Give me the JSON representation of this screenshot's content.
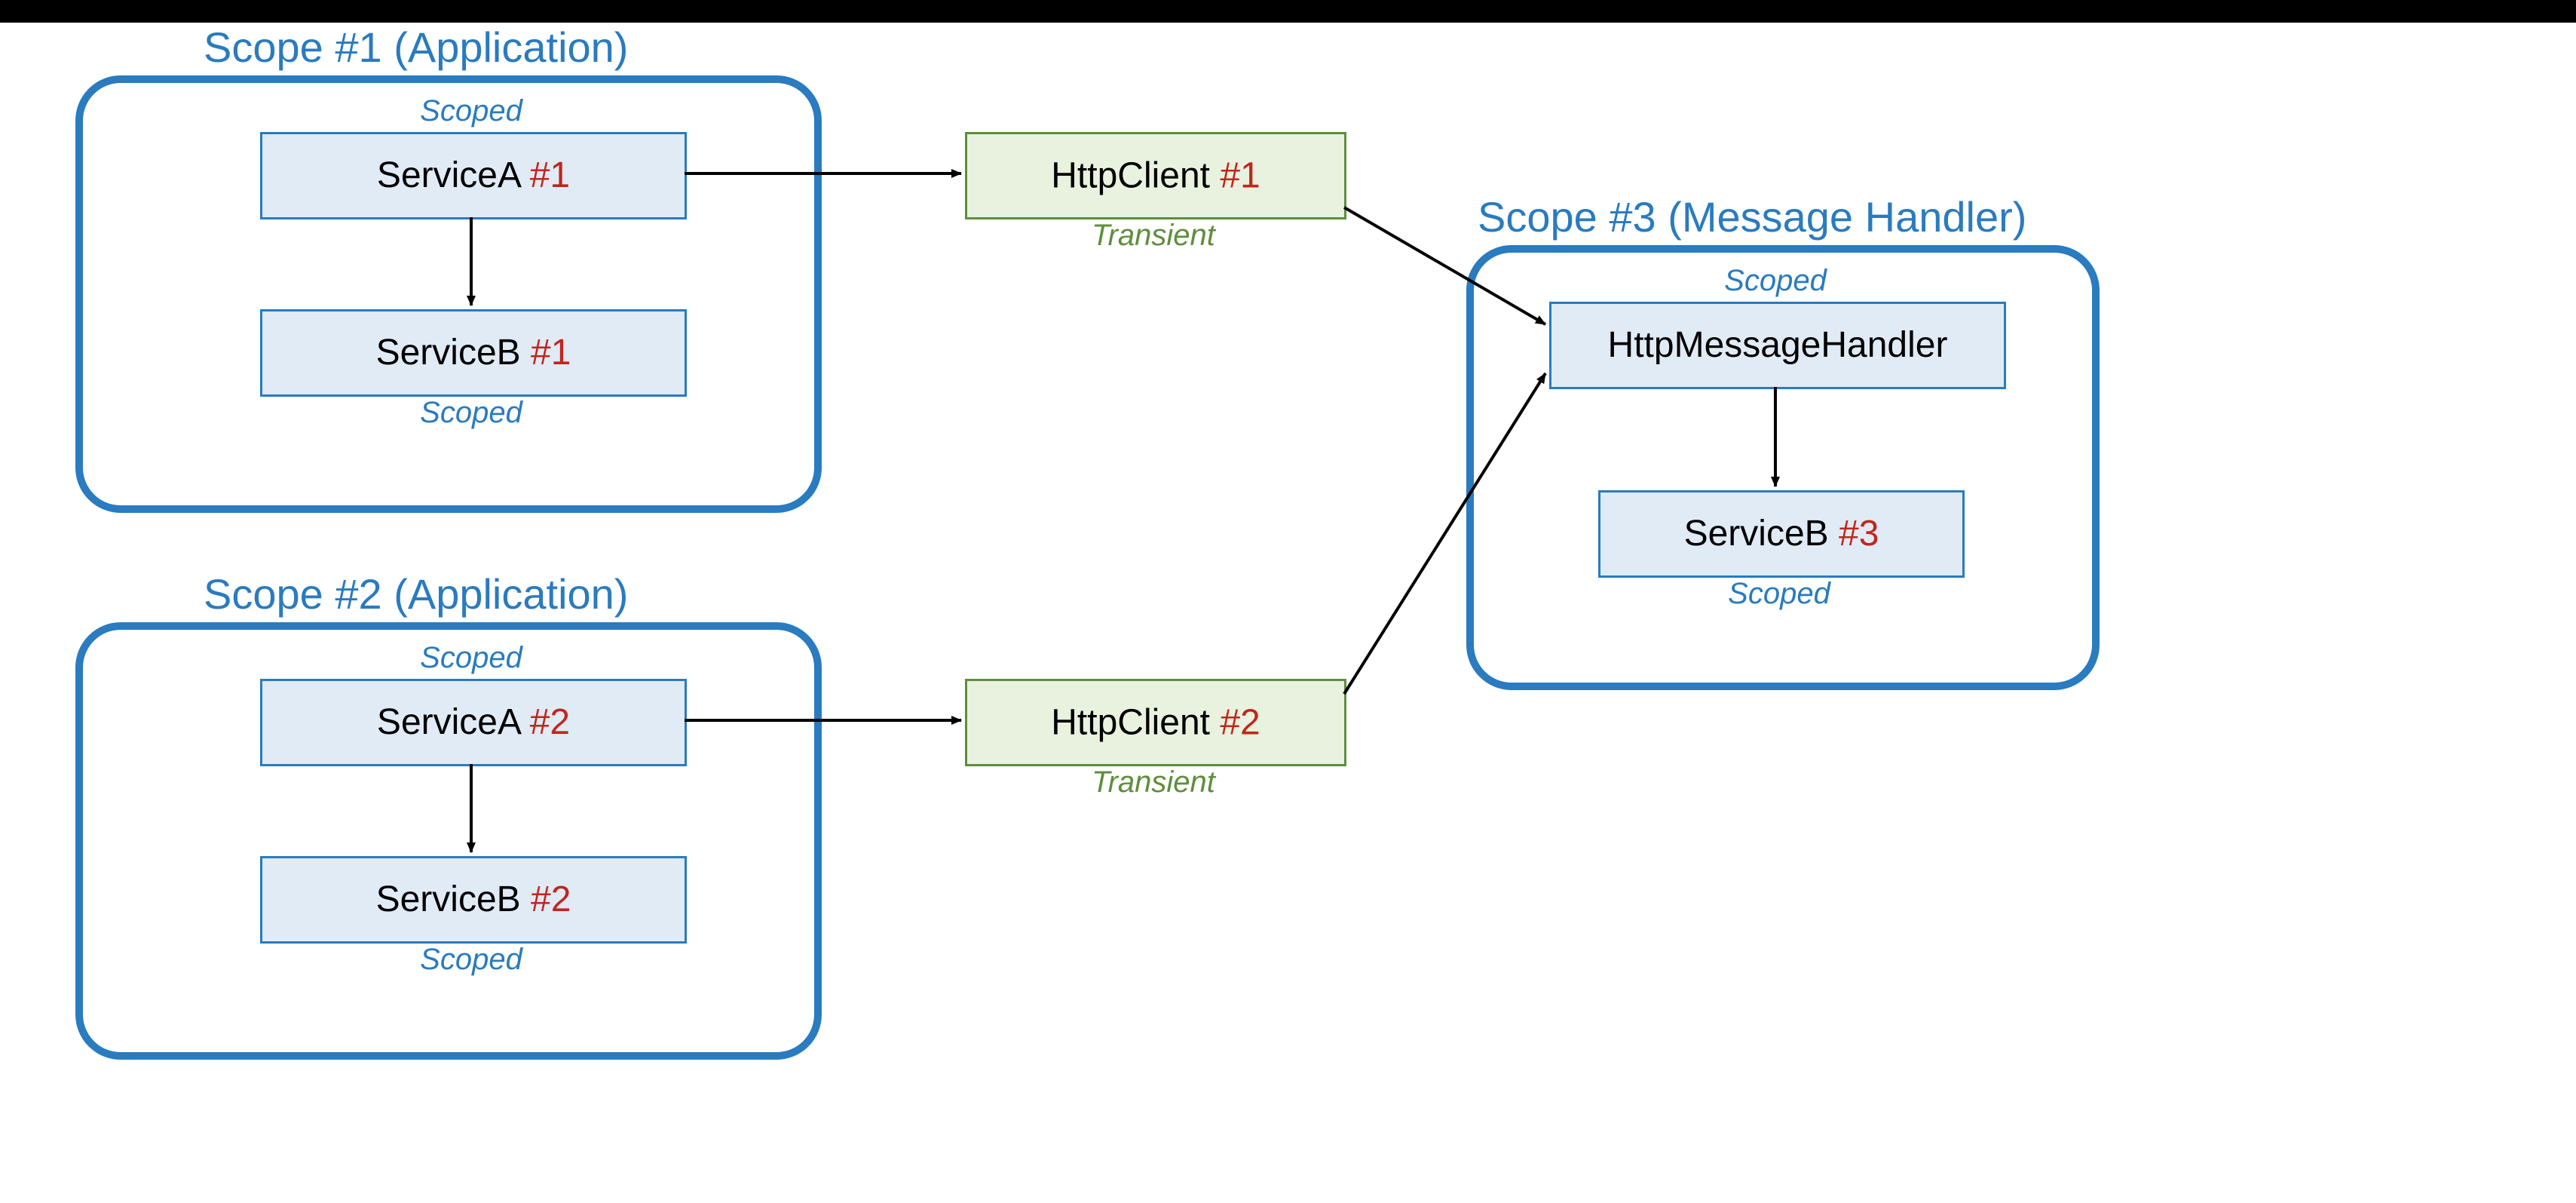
{
  "scopes": {
    "s1": {
      "title": "Scope #1 (Application)"
    },
    "s2": {
      "title": "Scope #2 (Application)"
    },
    "s3": {
      "title": "Scope #3 (Message Handler)"
    }
  },
  "lifetimes": {
    "scoped": "Scoped",
    "transient": "Transient"
  },
  "nodes": {
    "serviceA1": {
      "name": "ServiceA ",
      "idx": "#1"
    },
    "serviceB1": {
      "name": "ServiceB ",
      "idx": "#1"
    },
    "serviceA2": {
      "name": "ServiceA ",
      "idx": "#2"
    },
    "serviceB2": {
      "name": "ServiceB ",
      "idx": "#2"
    },
    "httpClient1": {
      "name": "HttpClient ",
      "idx": "#1"
    },
    "httpClient2": {
      "name": "HttpClient ",
      "idx": "#2"
    },
    "httpMsgHandler": {
      "name": "HttpMessageHandler",
      "idx": ""
    },
    "serviceB3": {
      "name": "ServiceB ",
      "idx": "#3"
    }
  },
  "colors": {
    "scopeBorder": "#2A7BBF",
    "svcFill": "#E0EBF6",
    "httpFill": "#E8F2DE",
    "httpBorder": "#5E8E3C",
    "idx": "#C0261C"
  }
}
